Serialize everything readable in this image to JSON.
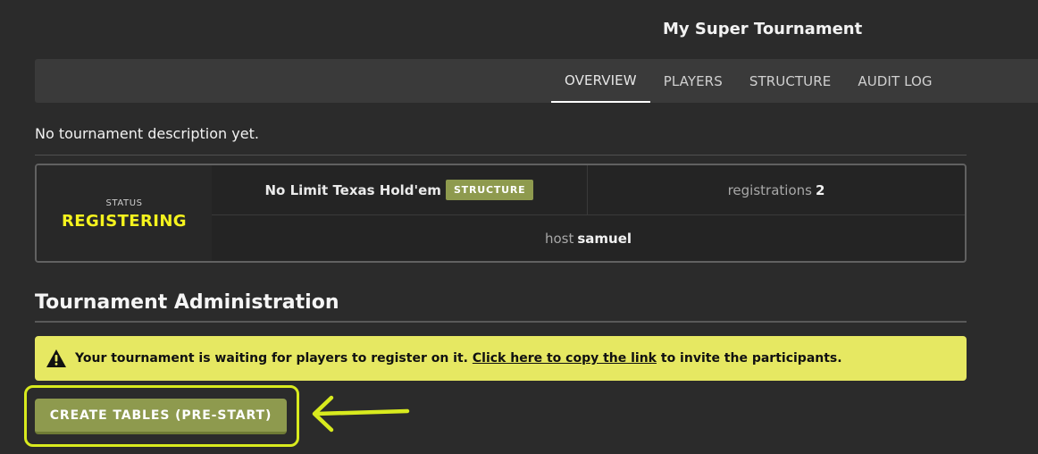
{
  "page": {
    "title": "My Super Tournament"
  },
  "tabs": [
    {
      "label": "OVERVIEW",
      "active": true
    },
    {
      "label": "PLAYERS",
      "active": false
    },
    {
      "label": "STRUCTURE",
      "active": false
    },
    {
      "label": "AUDIT LOG",
      "active": false
    }
  ],
  "overview": {
    "description": "No tournament description yet.",
    "status_label": "STATUS",
    "status_value": "REGISTERING",
    "game": "No Limit Texas Hold'em",
    "structure_badge": "STRUCTURE",
    "registrations_label": "registrations",
    "registrations_value": "2",
    "host_label": "host",
    "host_value": "samuel"
  },
  "admin": {
    "title": "Tournament Administration",
    "warning_before": "Your tournament is waiting for players to register on it.",
    "warning_link": "Click here to copy the link",
    "warning_after": "to invite the participants.",
    "button_label": "CREATE TABLES (PRE-START)"
  },
  "icons": {
    "warning": "warning-triangle-icon",
    "callout": "arrow-left-icon"
  },
  "colors": {
    "background": "#2b2b2b",
    "nav_background": "#3a3a3a",
    "status_yellow": "#f5f31e",
    "warning_background": "#e6e862",
    "button_background": "#8e9a4e",
    "highlight": "#d8ea1e"
  }
}
